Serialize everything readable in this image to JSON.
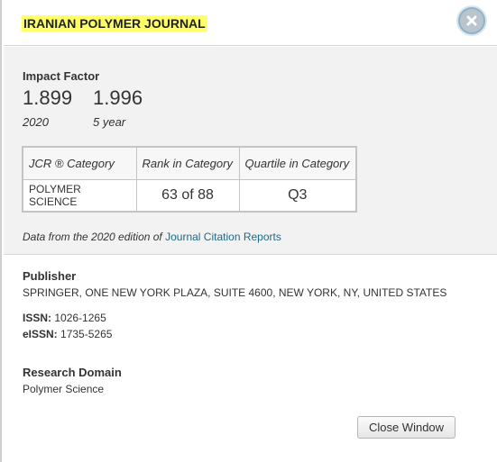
{
  "journal": {
    "title": "IRANIAN POLYMER JOURNAL"
  },
  "impact_factor": {
    "label": "Impact Factor",
    "values": [
      {
        "value": "1.899",
        "sub": "2020"
      },
      {
        "value": "1.996",
        "sub": "5 year"
      }
    ]
  },
  "jcr_table": {
    "headers": [
      "JCR ® Category",
      "Rank in Category",
      "Quartile in Category"
    ],
    "rows": [
      [
        "POLYMER SCIENCE",
        "63 of 88",
        "Q3"
      ]
    ]
  },
  "data_note": {
    "prefix": "Data from the 2020 edition of ",
    "link": "Journal Citation Reports"
  },
  "publisher": {
    "label": "Publisher",
    "value": "SPRINGER, ONE NEW YORK PLAZA, SUITE 4600, NEW YORK, NY, UNITED STATES"
  },
  "issn": {
    "label": "ISSN:",
    "value": "1026-1265"
  },
  "eissn": {
    "label": "eISSN:",
    "value": "1735-5265"
  },
  "research_domain": {
    "label": "Research Domain",
    "value": "Polymer Science"
  },
  "buttons": {
    "close_window": "Close Window"
  },
  "icons": {
    "close": "close-icon"
  },
  "colors": {
    "highlight": "#ffff66",
    "link": "#1a6a8a",
    "panel_bg": "#f2f2f2"
  }
}
